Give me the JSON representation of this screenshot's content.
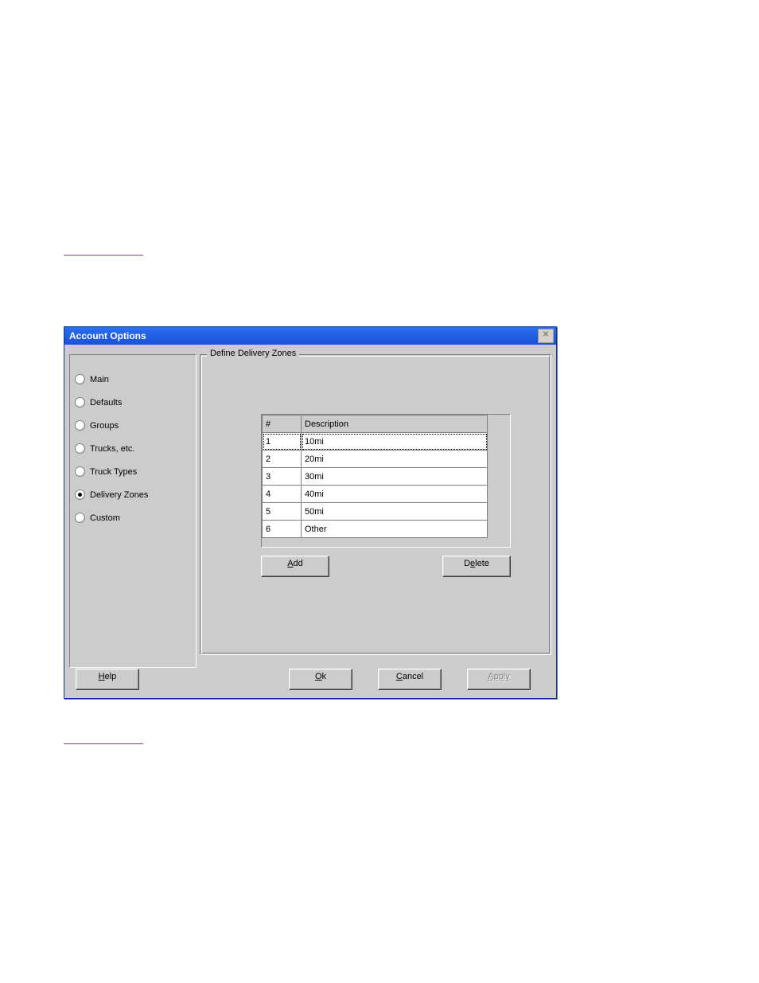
{
  "dialog": {
    "title": "Account Options",
    "nav": [
      {
        "label": "Main",
        "checked": false
      },
      {
        "label": "Defaults",
        "checked": false
      },
      {
        "label": "Groups",
        "checked": false
      },
      {
        "label": "Trucks, etc.",
        "checked": false
      },
      {
        "label": "Truck Types",
        "checked": false
      },
      {
        "label": "Delivery Zones",
        "checked": true
      },
      {
        "label": "Custom",
        "checked": false
      }
    ],
    "group": {
      "legend": "Define Delivery Zones",
      "columns": {
        "num": "#",
        "desc": "Description"
      },
      "rows": [
        {
          "num": "1",
          "desc": "10mi"
        },
        {
          "num": "2",
          "desc": "20mi"
        },
        {
          "num": "3",
          "desc": "30mi"
        },
        {
          "num": "4",
          "desc": "40mi"
        },
        {
          "num": "5",
          "desc": "50mi"
        },
        {
          "num": "6",
          "desc": "Other"
        }
      ],
      "buttons": {
        "add": {
          "accel": "A",
          "rest": "dd"
        },
        "delete": {
          "pre": "D",
          "accel": "e",
          "rest": "lete"
        }
      }
    },
    "buttons": {
      "help": {
        "accel": "H",
        "rest": "elp"
      },
      "ok": {
        "accel": "O",
        "rest": "k"
      },
      "cancel": {
        "accel": "C",
        "rest": "ancel"
      },
      "apply": {
        "text": "Apply",
        "enabled": false
      }
    }
  }
}
